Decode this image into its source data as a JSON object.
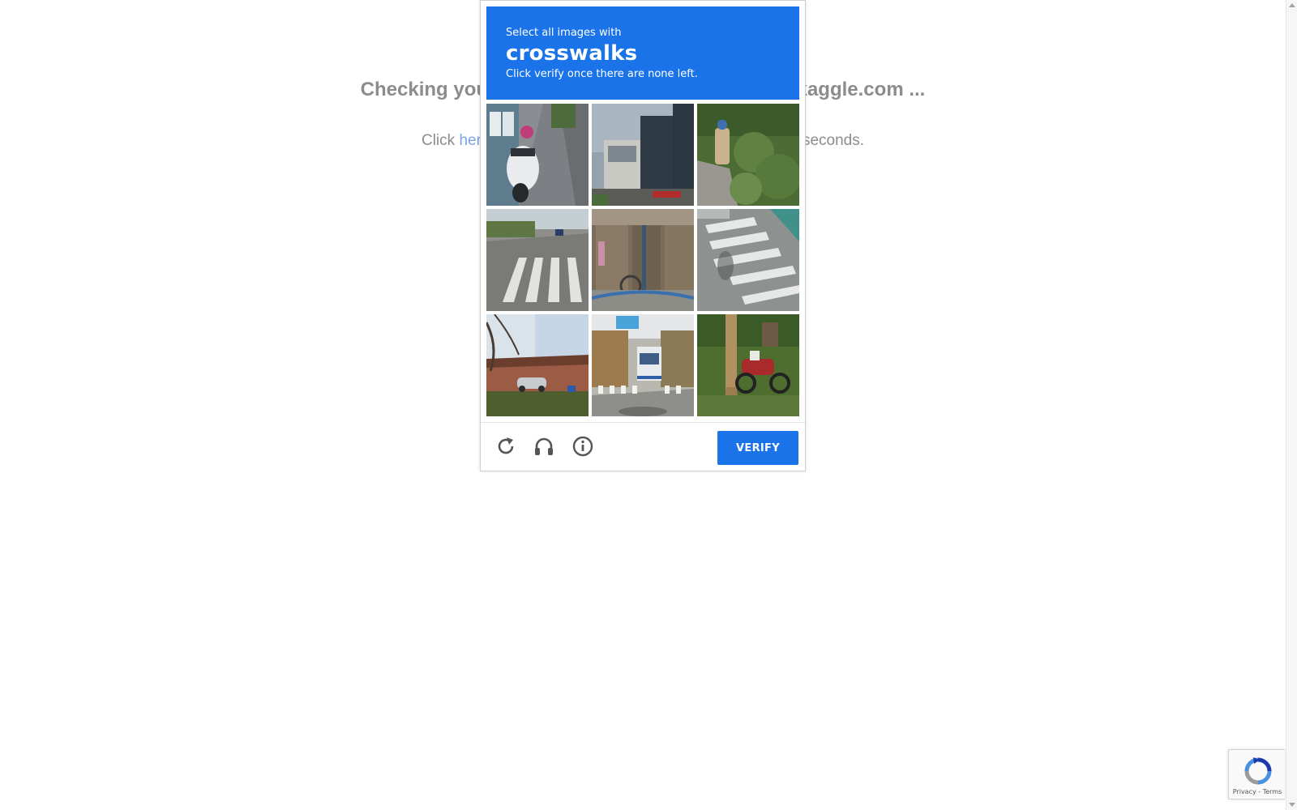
{
  "background_page": {
    "heading": "Checking your browser before accessing www.kaggle.com ...",
    "sub_prefix": "Click ",
    "sub_link": "here",
    "sub_suffix": " if you are not automatically redirected after 5 seconds."
  },
  "captcha": {
    "instruction_line1": "Select all images with",
    "keyword": "crosswalks",
    "instruction_line3": "Click verify once there are none left.",
    "tiles": [
      {
        "subject": "scooter-on-sidewalk"
      },
      {
        "subject": "city-buildings"
      },
      {
        "subject": "fire-hydrant"
      },
      {
        "subject": "crosswalk-street"
      },
      {
        "subject": "wooden-wall-bicycle"
      },
      {
        "subject": "crosswalk-closeup"
      },
      {
        "subject": "house-and-car"
      },
      {
        "subject": "bus-and-crosswalk"
      },
      {
        "subject": "motorcycle-by-tree"
      }
    ],
    "footer": {
      "reload_icon": "reload-icon",
      "audio_icon": "headphones-icon",
      "info_icon": "info-icon",
      "verify_label": "VERIFY"
    },
    "colors": {
      "accent": "#1a73e8"
    }
  },
  "badge": {
    "text": "Privacy - Terms"
  }
}
